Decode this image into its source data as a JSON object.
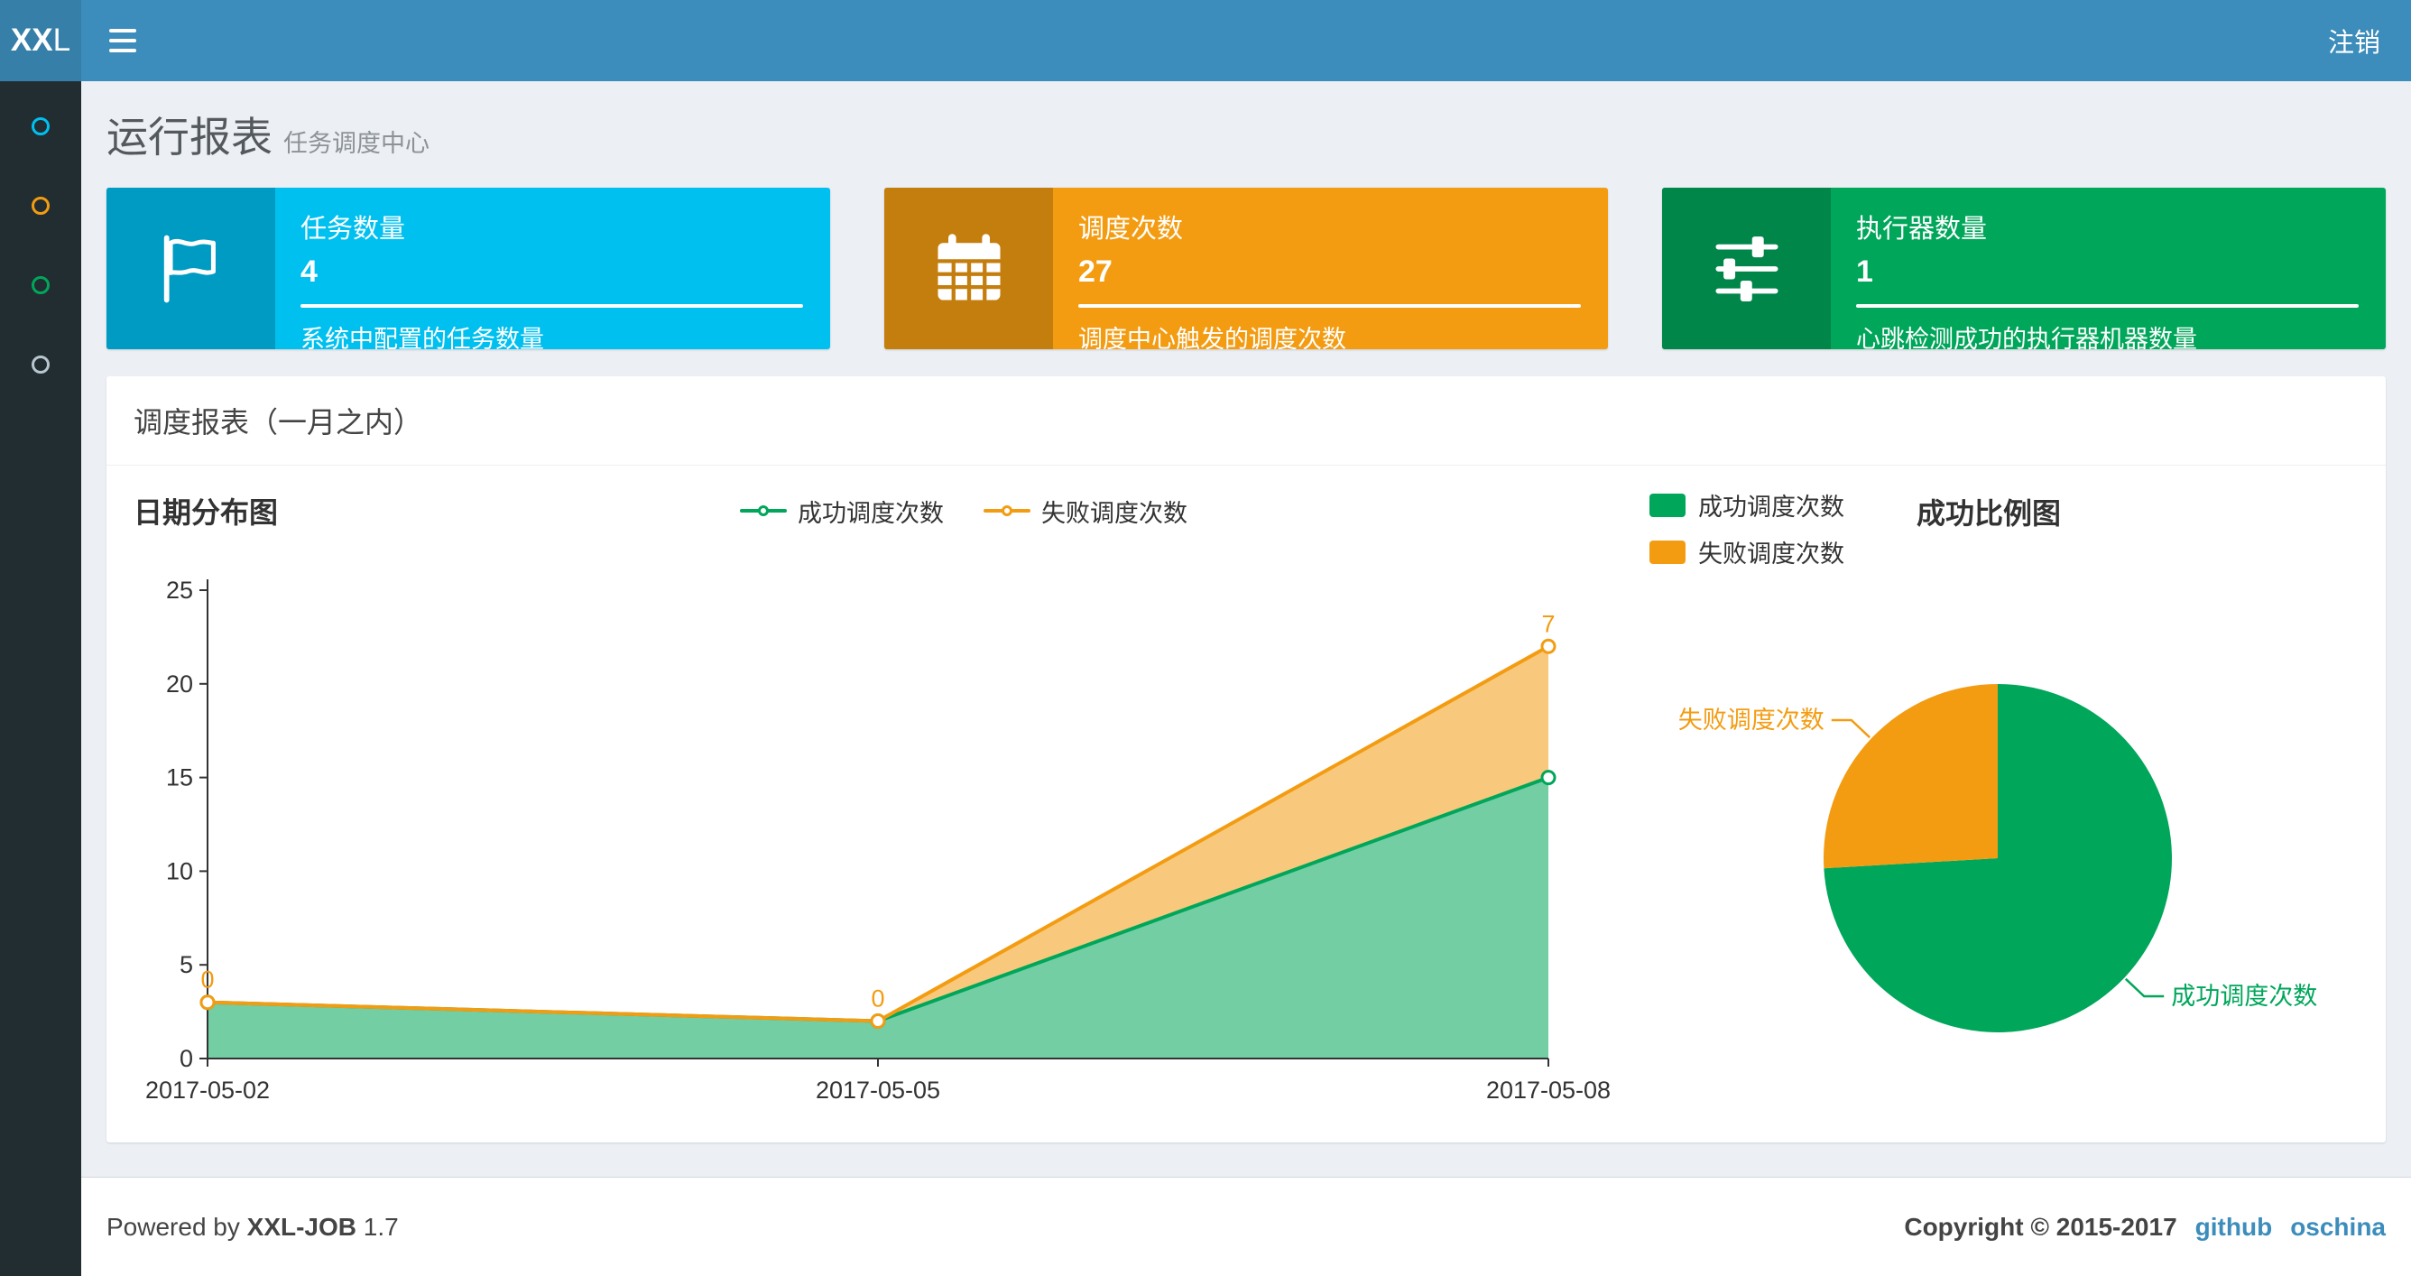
{
  "colors": {
    "navbar": "#3c8dbc",
    "navbar_logo": "#367fa9",
    "sidebar": "#222d32",
    "content_bg": "#ecf0f5",
    "link": "#3c8dbc"
  },
  "navbar": {
    "logo_bold": "XX",
    "logo_light": "L",
    "logout_label": "注销"
  },
  "sidebar": {
    "items": [
      {
        "color": "#00c0ef"
      },
      {
        "color": "#f39c12"
      },
      {
        "color": "#00a65a"
      },
      {
        "color": "#b8c7ce"
      }
    ]
  },
  "header": {
    "title": "运行报表",
    "subtitle": "任务调度中心"
  },
  "info_boxes": [
    {
      "title": "任务数量",
      "value": "4",
      "desc": "系统中配置的任务数量",
      "bg": "#00c0ef",
      "icon_bg": "#009bc2"
    },
    {
      "title": "调度次数",
      "value": "27",
      "desc": "调度中心触发的调度次数",
      "bg": "#f39c12",
      "icon_bg": "#c47e0e"
    },
    {
      "title": "执行器数量",
      "value": "1",
      "desc": "心跳检测成功的执行器机器数量",
      "bg": "#00a65a",
      "icon_bg": "#008649"
    }
  ],
  "report_panel": {
    "title": "调度报表（一月之内）"
  },
  "chart_data": [
    {
      "type": "area",
      "title": "日期分布图",
      "stacked": true,
      "grid": false,
      "legend_position": "top-center",
      "x": [
        "2017-05-02",
        "2017-05-05",
        "2017-05-08"
      ],
      "series": [
        {
          "name": "成功调度次数",
          "color": "#00a65a",
          "fill": "rgba(0,166,90,0.55)",
          "values": [
            3,
            2,
            15
          ],
          "show_value_labels": false
        },
        {
          "name": "失败调度次数",
          "color": "#f39c12",
          "fill": "rgba(243,156,18,0.55)",
          "values": [
            0,
            0,
            7
          ],
          "show_value_labels": true
        }
      ],
      "ylim": [
        0,
        25
      ],
      "yticks": [
        0,
        5,
        10,
        15,
        20,
        25
      ]
    },
    {
      "type": "pie",
      "title": "成功比例图",
      "legend_position": "top-left",
      "slices": [
        {
          "name": "成功调度次数",
          "value": 20,
          "color": "#00a65a"
        },
        {
          "name": "失败调度次数",
          "value": 7,
          "color": "#f39c12"
        }
      ]
    }
  ],
  "footer": {
    "powered_prefix": "Powered by",
    "product": "XXL-JOB",
    "version": "1.7",
    "copyright": "Copyright © 2015-2017",
    "links": [
      {
        "label": "github"
      },
      {
        "label": "oschina"
      }
    ]
  }
}
